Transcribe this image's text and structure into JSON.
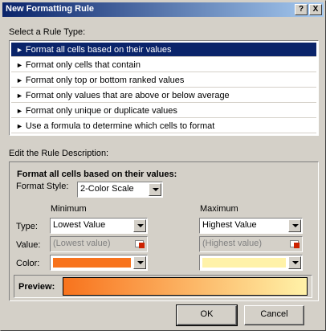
{
  "window": {
    "title": "New Formatting Rule",
    "help_label": "?",
    "close_label": "X"
  },
  "rule_type": {
    "label": "Select a Rule Type:",
    "items": [
      {
        "label": "Format all cells based on their values",
        "selected": true
      },
      {
        "label": "Format only cells that contain",
        "selected": false
      },
      {
        "label": "Format only top or bottom ranked values",
        "selected": false
      },
      {
        "label": "Format only values that are above or below average",
        "selected": false
      },
      {
        "label": "Format only unique or duplicate values",
        "selected": false
      },
      {
        "label": "Use a formula to determine which cells to format",
        "selected": false
      }
    ]
  },
  "description": {
    "label": "Edit the Rule Description:",
    "heading": "Format all cells based on their values:",
    "format_style_label": "Format Style:",
    "format_style_value": "2-Color Scale",
    "minimum_header": "Minimum",
    "maximum_header": "Maximum",
    "type_label": "Type:",
    "value_label": "Value:",
    "color_label": "Color:",
    "min_type": "Lowest Value",
    "max_type": "Highest Value",
    "min_value": "(Lowest value)",
    "max_value": "(Highest value)",
    "min_color": "#f8731d",
    "max_color": "#fff2a8",
    "preview_label": "Preview:"
  },
  "buttons": {
    "ok": "OK",
    "cancel": "Cancel"
  },
  "icons": {
    "help": "help-icon",
    "close": "close-icon",
    "dropdown": "chevron-down-icon",
    "cell_ref": "cell-reference-icon",
    "bullet": "triangle-right-icon"
  }
}
